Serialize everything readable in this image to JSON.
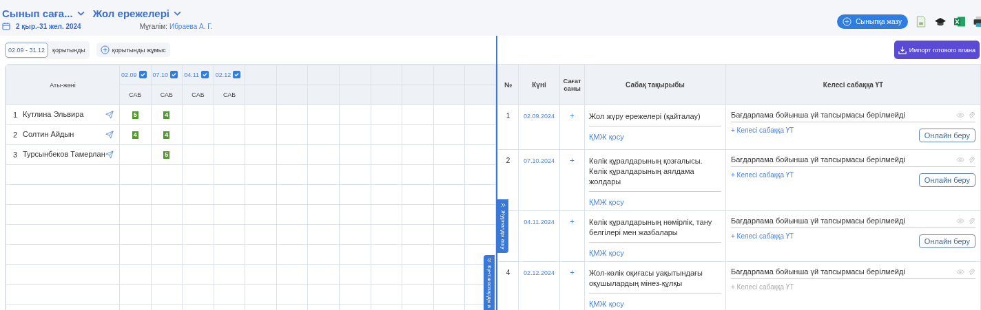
{
  "header": {
    "class_title": "Сынып саға...",
    "subject_title": "Жол ережелері",
    "period": "2 қыр.-31 жел. 2024",
    "teacher_label": "Мұғалім:",
    "teacher_name": "Ибраева А. Г.",
    "enroll_button": "Сыныпқа жазу"
  },
  "filters": {
    "range": "02.09 - 31.12",
    "summary": "қорытынды",
    "add_work": "қорытынды жұмыс"
  },
  "journal": {
    "name_header": "Аты-жөні",
    "date_columns": [
      {
        "date": "02.09",
        "checked": true,
        "type": "САБ"
      },
      {
        "date": "07.10",
        "checked": true,
        "type": "САБ"
      },
      {
        "date": "04.11",
        "checked": true,
        "type": "САБ"
      },
      {
        "date": "02.12",
        "checked": true,
        "type": "САБ"
      }
    ],
    "students": [
      {
        "number": "1",
        "name": "Кутлина Эльвира",
        "grades": [
          {
            "kind": "grade",
            "mark": "5"
          },
          {
            "kind": "grade",
            "mark": "4"
          },
          {
            "kind": "empty"
          },
          {
            "kind": "empty"
          }
        ]
      },
      {
        "number": "2",
        "name": "Солтин Айдын",
        "grades": [
          {
            "kind": "grade",
            "mark": "4"
          },
          {
            "kind": "grade",
            "mark": "4"
          },
          {
            "kind": "empty"
          },
          {
            "kind": "empty"
          }
        ]
      },
      {
        "number": "3",
        "name": "Турсынбеков Тамерлан",
        "grades": [
          {
            "kind": "empty"
          },
          {
            "kind": "grade",
            "mark": "5"
          },
          {
            "kind": "empty"
          },
          {
            "kind": "empty"
          }
        ]
      }
    ]
  },
  "side_tabs": [
    "Журналды ашу",
    "Күнт.жоспарды а"
  ],
  "plan": {
    "import_button": "Импорт готового плана",
    "columns": [
      "№",
      "Күні",
      "Сағат саны",
      "Сабақ тақырыбы",
      "Келесі сабаққа ҮТ"
    ],
    "rows": [
      {
        "number": "1",
        "date": "02.09.2024",
        "hours": "+",
        "topic": "Жол жүру ережелері (қайталау)",
        "kmzh": "ҚМЖ қосу",
        "homework": "Бағдарлама бойынша үй тапсырмасы берілмейді",
        "add_homework": "+ Келесі сабаққа ҮТ",
        "disabled": false,
        "online_button": "Онлайн беру"
      },
      {
        "number": "2",
        "date": "07.10.2024",
        "hours": "+",
        "topic": "Көлік құралдарының қозғалысы. Көлік құралдарының аялдама жолдары",
        "kmzh": "ҚМЖ қосу",
        "homework": "Бағдарлама бойынша үй тапсырмасы берілмейді",
        "add_homework": "+ Келесі сабаққа ҮТ",
        "disabled": false,
        "online_button": "Онлайн беру"
      },
      {
        "date": "04.11.2024",
        "hours": "+",
        "topic": "Көлік құралдарының нөмірлік, тану белгілері мен жазбалары",
        "kmzh": "ҚМЖ қосу",
        "homework": "Бағдарлама бойынша үй тапсырмасы берілмейді",
        "add_homework": "+ Келесі сабаққа ҮТ",
        "disabled": false,
        "online_button": "Онлайн беру"
      },
      {
        "number": "4",
        "date": "02.12.2024",
        "hours": "+",
        "topic": "Жол-көлік оқиғасы уақытындағы оқушылардың мінез-құлқы",
        "kmzh": "ҚМЖ қосу",
        "homework": "Бағдарлама бойынша үй тапсырмасы берілмейді",
        "add_homework": "+ Келесі сабаққа ҮТ",
        "disabled": true
      }
    ]
  }
}
